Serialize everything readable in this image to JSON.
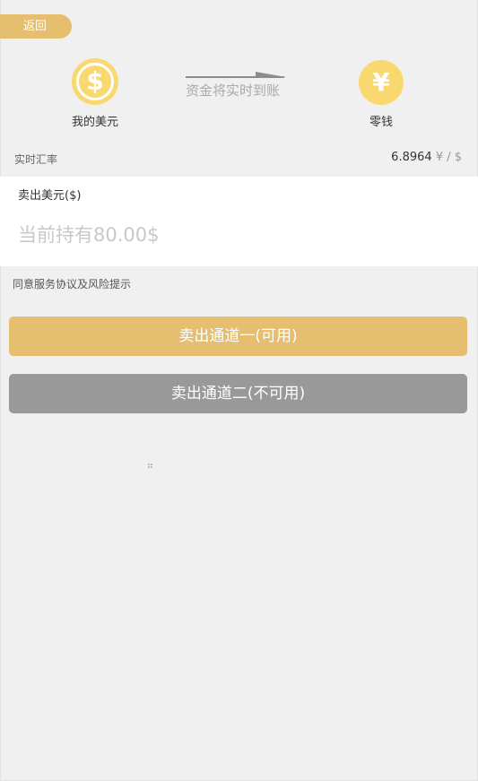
{
  "header": {
    "back_label": "返回"
  },
  "transfer": {
    "from_label": "我的美元",
    "to_label": "零钱",
    "arrow_text": "资金将实时到账",
    "usd_symbol": "$",
    "cny_symbol": "¥"
  },
  "rate": {
    "label": "实时汇率",
    "value": "6.8964",
    "unit": "¥ / $"
  },
  "sell": {
    "label": "卖出美元($)",
    "placeholder": "当前持有80.00$",
    "value": ""
  },
  "agreement_text": "同意服务协议及风险提示",
  "channels": {
    "one_label": "卖出通道一(可用)",
    "two_label": "卖出通道二(不可用)"
  },
  "colors": {
    "accent": "#e6be6f",
    "coin": "#f9d870",
    "disabled": "#999999",
    "background": "#f0f0f0"
  }
}
